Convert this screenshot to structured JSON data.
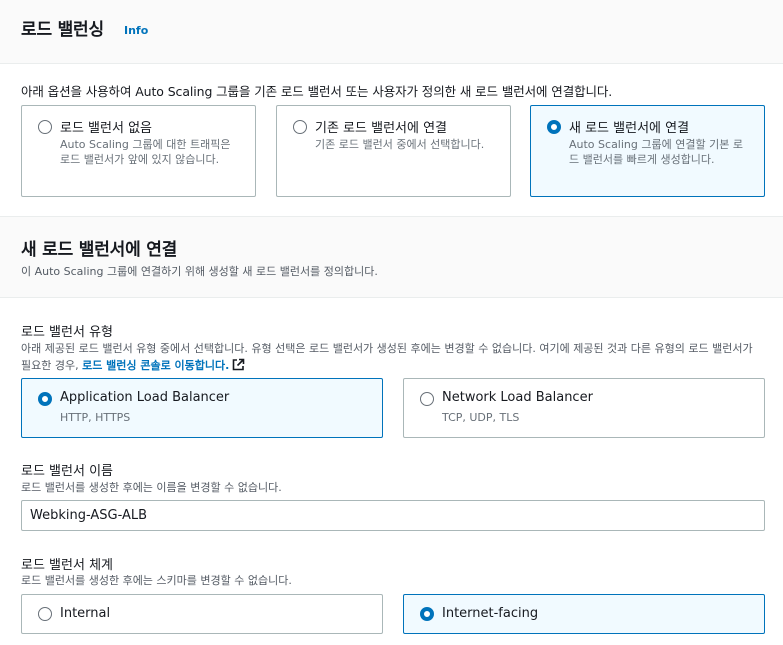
{
  "section1": {
    "title": "로드 밸런싱",
    "info_link": "Info",
    "description": "아래 옵션을 사용하여 Auto Scaling 그룹을 기존 로드 밸런서 또는 사용자가 정의한 새 로드 밸런서에 연결합니다.",
    "options": [
      {
        "label": "로드 밸런서 없음",
        "desc": "Auto Scaling 그룹에 대한 트래픽은 로드 밸런서가 앞에 있지 않습니다.",
        "selected": false
      },
      {
        "label": "기존 로드 밸런서에 연결",
        "desc": "기존 로드 밸런서 중에서 선택합니다.",
        "selected": false
      },
      {
        "label": "새 로드 밸런서에 연결",
        "desc": "Auto Scaling 그룹에 연결할 기본 로드 밸런서를 빠르게 생성합니다.",
        "selected": true
      }
    ]
  },
  "section2": {
    "title": "새 로드 밸런서에 연결",
    "description": "이 Auto Scaling 그룹에 연결하기 위해 생성할 새 로드 밸런서를 정의합니다.",
    "lb_type": {
      "label": "로드 밸런서 유형",
      "desc": "아래 제공된 로드 밸런서 유형 중에서 선택합니다. 유형 선택은 로드 밸런서가 생성된 후에는 변경할 수 없습니다. 여기에 제공된 것과 다른 유형의 로드 밸런서가 필요한 경우,",
      "link": "로드 밸런싱 콘솔로 이동합니다.",
      "options": [
        {
          "label": "Application Load Balancer",
          "sub": "HTTP, HTTPS",
          "selected": true
        },
        {
          "label": "Network Load Balancer",
          "sub": "TCP, UDP, TLS",
          "selected": false
        }
      ]
    },
    "lb_name": {
      "label": "로드 밸런서 이름",
      "desc": "로드 밸런서를 생성한 후에는 이름을 변경할 수 없습니다.",
      "value": "Webking-ASG-ALB"
    },
    "lb_scheme": {
      "label": "로드 밸런서 체계",
      "desc": "로드 밸런서를 생성한 후에는 스키마를 변경할 수 없습니다.",
      "options": [
        {
          "label": "Internal",
          "selected": false
        },
        {
          "label": "Internet-facing",
          "selected": true
        }
      ]
    }
  },
  "colors": {
    "accent": "#0073bb",
    "selected_bg": "#f1faff",
    "border": "#aab7b8",
    "muted": "#687078"
  }
}
